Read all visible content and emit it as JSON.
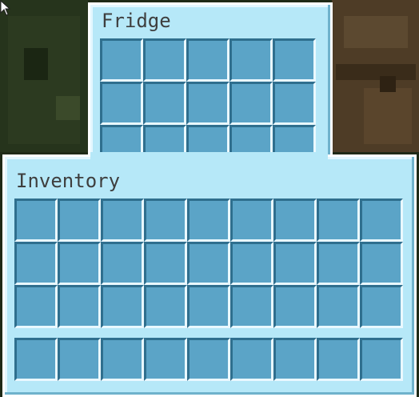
{
  "fridge": {
    "title": "Fridge",
    "rows": 3,
    "cols": 5
  },
  "inventory": {
    "title": "Inventory",
    "rows": 3,
    "cols": 9,
    "hotbar_slots": 9
  },
  "colors": {
    "panel": "#b6e8f8",
    "slot": "#5ba4c7",
    "slot_border": "#2f6f8e",
    "text": "#3e3e3e"
  }
}
